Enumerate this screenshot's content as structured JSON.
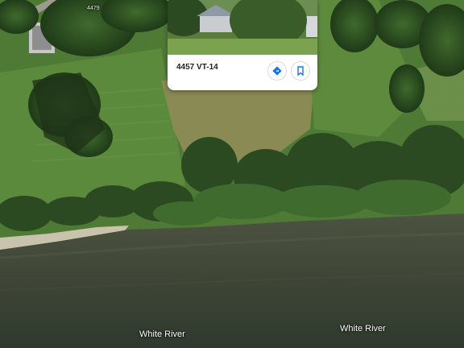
{
  "map": {
    "road_label": "4479",
    "water_labels": [
      {
        "text": "White River"
      },
      {
        "text": "White River"
      }
    ]
  },
  "place_card": {
    "title": "4457 VT-14",
    "icons": [
      "directions-icon",
      "bookmark-icon"
    ],
    "accent_color": "#1a73e8"
  }
}
